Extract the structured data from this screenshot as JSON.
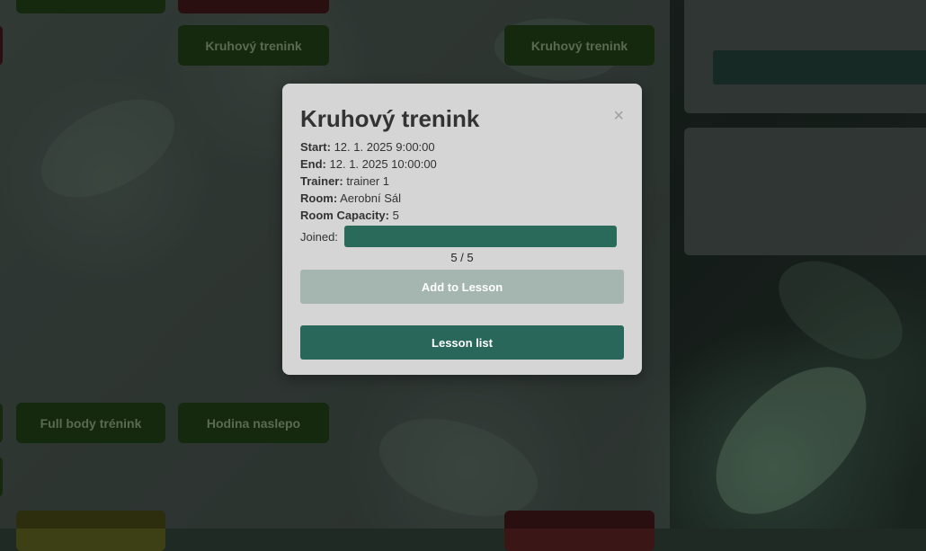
{
  "schedule": {
    "lessons": [
      {
        "label": "Kruhový trenink"
      },
      {
        "label": "Kruhový trenink"
      },
      {
        "label": "Full body trénink"
      },
      {
        "label": "Hodina naslepo"
      }
    ]
  },
  "modal": {
    "title": "Kruhový trenink",
    "close_glyph": "×",
    "start_label": "Start:",
    "start_value": "12. 1. 2025 9:00:00",
    "end_label": "End:",
    "end_value": "12. 1. 2025 10:00:00",
    "trainer_label": "Trainer:",
    "trainer_value": "trainer 1",
    "room_label": "Room:",
    "room_value": "Aerobní Sál",
    "capacity_label": "Room Capacity:",
    "capacity_value": "5",
    "joined_label": "Joined:",
    "joined_fraction": 1.0,
    "joined_count": "5 / 5",
    "add_button": "Add to Lesson",
    "list_button": "Lesson list"
  },
  "colors": {
    "primary": "#29675a",
    "disabled": "#a5b5b0",
    "lesson_green": "#1e3a16",
    "lesson_red": "#3a1616"
  }
}
